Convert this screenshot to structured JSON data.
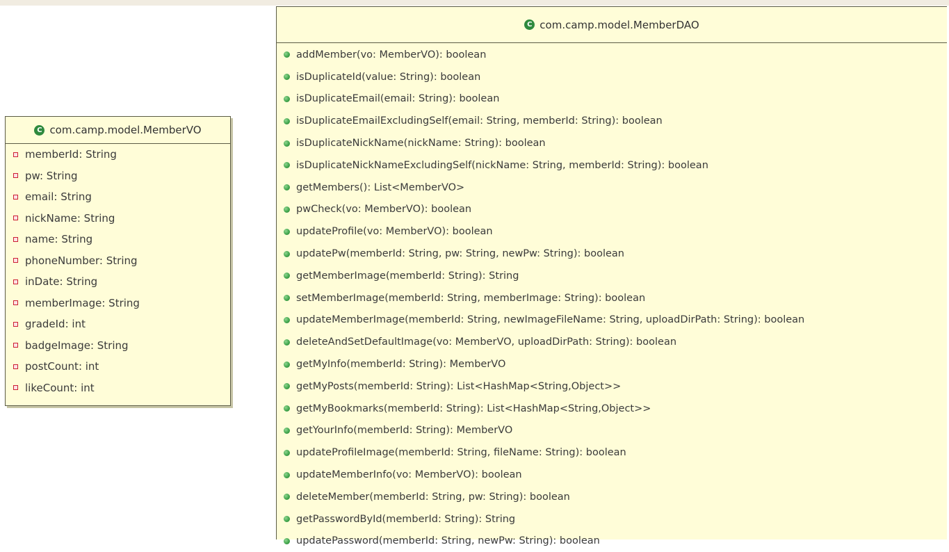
{
  "member_vo": {
    "class_name": "com.camp.model.MemberVO",
    "fields": [
      "memberId: String",
      "pw: String",
      "email: String",
      "nickName: String",
      "name: String",
      "phoneNumber: String",
      "inDate: String",
      "memberImage: String",
      "gradeId: int",
      "badgeImage: String",
      "postCount: int",
      "likeCount: int"
    ]
  },
  "member_dao": {
    "class_name": "com.camp.model.MemberDAO",
    "methods": [
      "addMember(vo: MemberVO): boolean",
      "isDuplicateId(value: String): boolean",
      "isDuplicateEmail(email: String): boolean",
      "isDuplicateEmailExcludingSelf(email: String, memberId: String): boolean",
      "isDuplicateNickName(nickName: String): boolean",
      "isDuplicateNickNameExcludingSelf(nickName: String, memberId: String): boolean",
      "getMembers(): List<MemberVO>",
      "pwCheck(vo: MemberVO): boolean",
      "updateProfile(vo: MemberVO): boolean",
      "updatePw(memberId: String, pw: String, newPw: String): boolean",
      "getMemberImage(memberId: String): String",
      "setMemberImage(memberId: String, memberImage: String): boolean",
      "updateMemberImage(memberId: String, newImageFileName: String, uploadDirPath: String): boolean",
      "deleteAndSetDefaultImage(vo: MemberVO, uploadDirPath: String): boolean",
      "getMyInfo(memberId: String): MemberVO",
      "getMyPosts(memberId: String): List<HashMap<String,Object>>",
      "getMyBookmarks(memberId: String): List<HashMap<String,Object>>",
      "getYourInfo(memberId: String): MemberVO",
      "updateProfileImage(memberId: String, fileName: String): boolean",
      "updateMemberInfo(vo: MemberVO): boolean",
      "deleteMember(memberId: String, pw: String): boolean",
      "getPasswordById(memberId: String): String",
      "updatePassword(memberId: String, newPw: String): boolean"
    ]
  },
  "icons": {
    "class_icon_letter": "C",
    "class_icon_color": "#2f8a3e",
    "field_icon": "private-field-icon",
    "method_icon": "public-method-icon",
    "field_icon_color": "#cc2033",
    "method_icon_color": "#3ea34a",
    "box_fill": "#fffdd8"
  }
}
